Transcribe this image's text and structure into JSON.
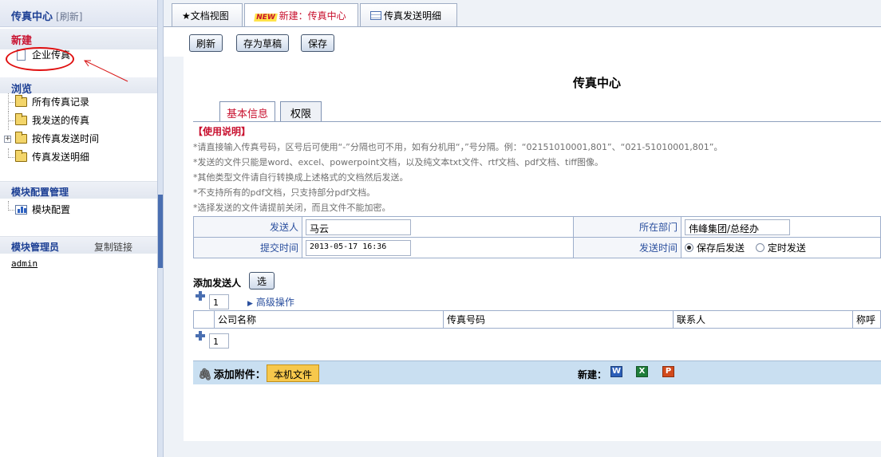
{
  "sidebar": {
    "title": "传真中心",
    "refresh": "[刷新]",
    "section_new": "新建",
    "new_items": [
      {
        "label": "企业传真"
      }
    ],
    "section_browse": "浏览",
    "browse_items": [
      {
        "label": "所有传真记录"
      },
      {
        "label": "我发送的传真"
      },
      {
        "label": "按传真发送时间"
      },
      {
        "label": "传真发送明细"
      }
    ],
    "section_config": "模块配置管理",
    "config_items": [
      {
        "label": "模块配置"
      }
    ],
    "section_admin": "模块管理员",
    "copy_link": "复制链接",
    "admin_user": "admin"
  },
  "tabs": [
    {
      "label": "★文档视图"
    },
    {
      "badge": "NEW",
      "label": "新建：传真中心"
    },
    {
      "label": "传真发送明细"
    }
  ],
  "toolbar": {
    "refresh": "刷新",
    "save_draft": "存为草稿",
    "save": "保存"
  },
  "form": {
    "title": "传真中心",
    "tabs": [
      {
        "label": "基本信息"
      },
      {
        "label": "权限"
      }
    ],
    "instructions_title": "【使用说明】",
    "instructions": [
      "*请直接输入传真号码，区号后可使用“-”分隔也可不用，如有分机用“，”号分隔。例：“02151010001,801”、“021-51010001,801”。",
      "*发送的文件只能是word、excel、powerpoint文档，以及纯文本txt文件、rtf文档、pdf文档、tiff图像。",
      "*其他类型文件请自行转换成上述格式的文档然后发送。",
      "*不支持所有的pdf文档，只支持部分pdf文档。",
      "*选择发送的文件请提前关闭，而且文件不能加密。"
    ],
    "sender_label": "发送人",
    "sender_value": "马云",
    "dept_label": "所在部门",
    "dept_value": "伟峰集团/总经办",
    "submit_time_label": "提交时间",
    "submit_time_value": "2013-05-17 16:36",
    "send_time_label": "发送时间",
    "send_options": [
      {
        "label": "保存后发送",
        "checked": true
      },
      {
        "label": "定时发送",
        "checked": false
      }
    ],
    "add_recipient_label": "添加发送人",
    "select_button": "选",
    "count_top": "1",
    "advanced": "高级操作",
    "columns": [
      "公司名称",
      "传真号码",
      "联系人",
      "称呼"
    ],
    "count_bottom": "1",
    "attachment_label": "添加附件：",
    "local_file_button": "本机文件",
    "new_label": "新建：",
    "new_icons": [
      "W",
      "X",
      "P"
    ],
    "colors": {
      "word": "#2b5eb8",
      "excel": "#1e7d3a",
      "ppt": "#d24a1c"
    }
  }
}
